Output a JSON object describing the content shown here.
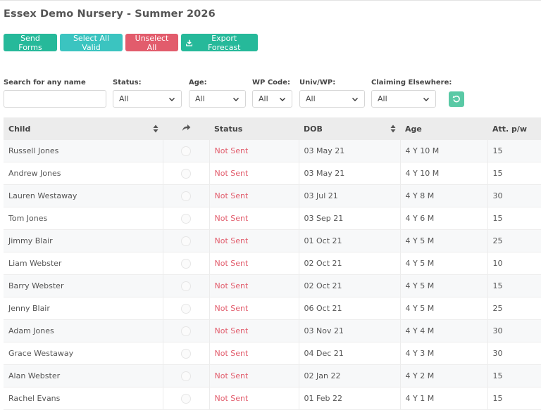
{
  "page": {
    "title": "Essex Demo Nursery - Summer 2026"
  },
  "actions": {
    "send_forms": "Send Forms",
    "select_all_valid": "Select All Valid",
    "unselect_all": "Unselect All",
    "export_forecast": "Export Forecast"
  },
  "filters": {
    "search": {
      "label": "Search for any name",
      "value": "",
      "placeholder": ""
    },
    "status": {
      "label": "Status:",
      "value": "All"
    },
    "age": {
      "label": "Age:",
      "value": "All"
    },
    "wp_code": {
      "label": "WP Code:",
      "value": "All"
    },
    "univ_wp": {
      "label": "Univ/WP:",
      "value": "All"
    },
    "claiming_elsewhere": {
      "label": "Claiming Elsewhere:",
      "value": "All"
    }
  },
  "colors": {
    "send_forms": "#26b99a",
    "select_all_valid": "#3bc4c0",
    "unselect_all": "#e25c6c",
    "export_forecast": "#26b99a",
    "not_sent": "#e25c6c",
    "reset": "#59c9a5"
  },
  "icons": {
    "export": "download-icon",
    "reset": "refresh-icon",
    "share": "share-icon",
    "sort": "sort-icon",
    "dropdown": "chevron-down-icon"
  },
  "table": {
    "columns": [
      "Child",
      "",
      "Status",
      "DOB",
      "Age",
      "Att. p/w"
    ],
    "rows": [
      {
        "child": "Russell Jones",
        "status": "Not Sent",
        "dob": "03 May 21",
        "age": "4 Y 10 M",
        "att": "15"
      },
      {
        "child": "Andrew Jones",
        "status": "Not Sent",
        "dob": "03 May 21",
        "age": "4 Y 10 M",
        "att": "15"
      },
      {
        "child": "Lauren Westaway",
        "status": "Not Sent",
        "dob": "03 Jul 21",
        "age": "4 Y 8 M",
        "att": "30"
      },
      {
        "child": "Tom Jones",
        "status": "Not Sent",
        "dob": "03 Sep 21",
        "age": "4 Y 6 M",
        "att": "15"
      },
      {
        "child": "Jimmy Blair",
        "status": "Not Sent",
        "dob": "01 Oct 21",
        "age": "4 Y 5 M",
        "att": "25"
      },
      {
        "child": "Liam Webster",
        "status": "Not Sent",
        "dob": "02 Oct 21",
        "age": "4 Y 5 M",
        "att": "10"
      },
      {
        "child": "Barry Webster",
        "status": "Not Sent",
        "dob": "02 Oct 21",
        "age": "4 Y 5 M",
        "att": "15"
      },
      {
        "child": "Jenny Blair",
        "status": "Not Sent",
        "dob": "06 Oct 21",
        "age": "4 Y 5 M",
        "att": "25"
      },
      {
        "child": "Adam Jones",
        "status": "Not Sent",
        "dob": "03 Nov 21",
        "age": "4 Y 4 M",
        "att": "30"
      },
      {
        "child": "Grace Westaway",
        "status": "Not Sent",
        "dob": "04 Dec 21",
        "age": "4 Y 3 M",
        "att": "30"
      },
      {
        "child": "Alan Webster",
        "status": "Not Sent",
        "dob": "02 Jan 22",
        "age": "4 Y 2 M",
        "att": "15"
      },
      {
        "child": "Rachel Evans",
        "status": "Not Sent",
        "dob": "01 Feb 22",
        "age": "4 Y 1 M",
        "att": "15"
      }
    ]
  }
}
